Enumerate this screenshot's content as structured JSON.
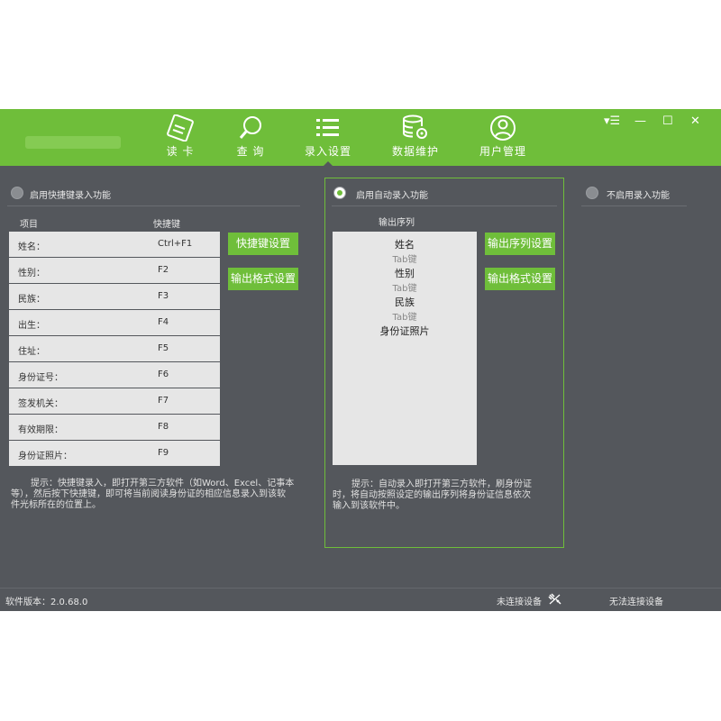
{
  "nav": {
    "read_card": "读 卡",
    "query": "查 询",
    "input_settings": "录入设置",
    "data_maintenance": "数据维护",
    "user_management": "用户管理"
  },
  "window_controls": {
    "menu": "▾☰",
    "minimize": "—",
    "maximize": "☐",
    "close": "✕"
  },
  "shortcut_panel": {
    "radio_label": "启用快捷键录入功能",
    "col_item": "项目",
    "col_shortcut": "快捷键",
    "rows": [
      {
        "name": "姓名：",
        "key": "Ctrl+F1"
      },
      {
        "name": "性别：",
        "key": "F2"
      },
      {
        "name": "民族：",
        "key": "F3"
      },
      {
        "name": "出生：",
        "key": "F4"
      },
      {
        "name": "住址：",
        "key": "F5"
      },
      {
        "name": "身份证号：",
        "key": "F6"
      },
      {
        "name": "签发机关：",
        "key": "F7"
      },
      {
        "name": "有效期限：",
        "key": "F8"
      },
      {
        "name": "身份证照片：",
        "key": "F9"
      }
    ],
    "btn_shortcut_settings": "快捷键设置",
    "btn_output_format": "输出格式设置",
    "tip_line1": "提示：快捷键录入，即打开第三方软件（如Word、Excel、记事本",
    "tip_line2": "等），然后按下快捷键，即可将当前阅读身份证的相应信息录入到该软",
    "tip_line3": "件光标所在的位置上。"
  },
  "auto_panel": {
    "radio_label": "启用自动录入功能",
    "seq_header": "输出序列",
    "sequence": [
      "姓名",
      "Tab键",
      "性别",
      "Tab键",
      "民族",
      "Tab键",
      "身份证照片"
    ],
    "btn_output_sequence": "输出序列设置",
    "btn_output_format": "输出格式设置",
    "tip_line1": "提示：自动录入即打开第三方软件，刷身份证",
    "tip_line2": "时，将自动按照设定的输出序列将身份证信息依次",
    "tip_line3": "输入到该软件中。"
  },
  "disable_panel": {
    "radio_label": "不启用录入功能"
  },
  "status": {
    "version": "软件版本：2.0.68.0",
    "device": "未连接设备",
    "connect": "无法连接设备"
  },
  "colors": {
    "accent": "#6fbe3a",
    "background": "#54575c"
  }
}
